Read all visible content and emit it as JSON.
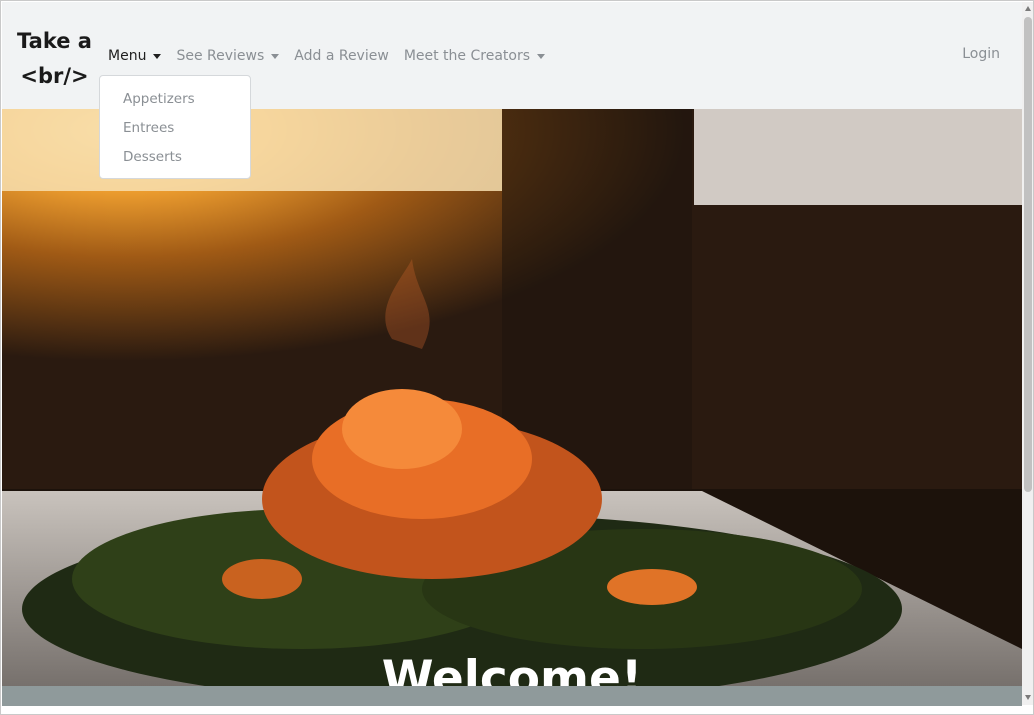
{
  "brand": {
    "line1": "Take a",
    "line2": "<br/>"
  },
  "nav": {
    "menu": "Menu",
    "see_reviews": "See Reviews",
    "add_review": "Add a Review",
    "meet_creators": "Meet the Creators",
    "login": "Login"
  },
  "menu_dropdown": {
    "items": [
      "Appetizers",
      "Entrees",
      "Desserts"
    ]
  },
  "hero": {
    "title": "Welcome!"
  },
  "colors": {
    "navbar_bg": "#f1f3f4",
    "hero_band": "#8f9a9b",
    "link": "#8a8f94",
    "active_link": "#1f1f1f"
  }
}
